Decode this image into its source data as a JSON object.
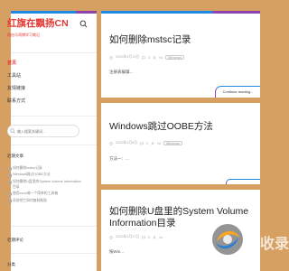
{
  "site": {
    "title": "红旗在飘扬CN",
    "subtitle": "随由马哥博学习笔记"
  },
  "nav": {
    "items": [
      {
        "label": "首页",
        "active": true
      },
      {
        "label": "工具站",
        "active": false
      },
      {
        "label": "友情链接",
        "active": false
      },
      {
        "label": "联系方式",
        "active": false
      }
    ]
  },
  "search": {
    "placeholder": "输入搜索关键词..."
  },
  "widgets": {
    "recent_title": "近期文章",
    "recent_posts": [
      "如何删除mstsc记录",
      "Windows跳过OOBE方法",
      "如何删除U盘里的System Volume Information目录",
      "使用echo做一个简单的工具箱",
      "奇迹吧兰如何复制粘贴"
    ],
    "comments_title": "近期评论",
    "categories_title": "分类"
  },
  "posts": [
    {
      "title": "如何删除mstsc记录",
      "date": "2023年4月13日",
      "comments": "2",
      "author": "hc",
      "tag": "Windows",
      "excerpt": "注册表编辑...",
      "continue": "Continue reading..."
    },
    {
      "title": "Windows跳过OOBE方法",
      "date": "2023年4月6日",
      "comments": "2",
      "author": "hc",
      "tag": "Windows",
      "excerpt": "方法一：..."
    },
    {
      "title": "如何删除U盘里的System Volume Information目录",
      "title_line1": "如何删除U盘里的System Volume",
      "title_line2": "Information目录",
      "date": "2023年3月27日",
      "comments": "0",
      "author": "hc",
      "tag": "Windows",
      "excerpt": "按Win..."
    }
  ],
  "watermark": {
    "text": "快收录"
  },
  "colors": {
    "background": "#d6a063",
    "accent_blue": "#1e88e5",
    "accent_purple": "#8e44ad",
    "brand_red": "#e53935"
  }
}
